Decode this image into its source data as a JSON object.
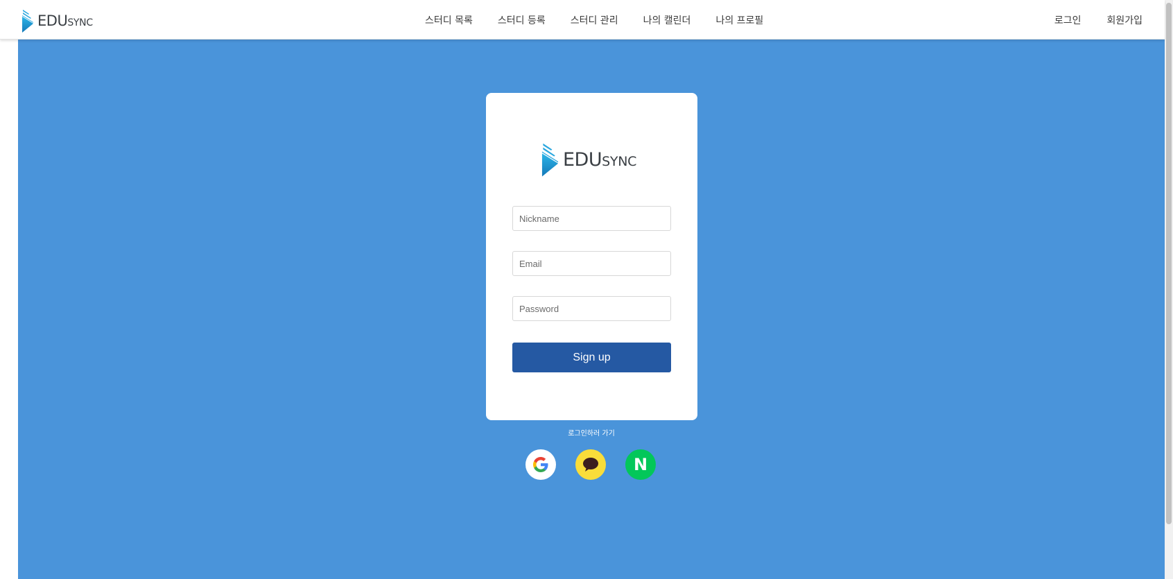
{
  "brand": {
    "name_main": "EDU",
    "name_sub": "SYNC"
  },
  "header": {
    "nav": [
      {
        "label": "스터디 목록"
      },
      {
        "label": "스터디 등록"
      },
      {
        "label": "스터디 관리"
      },
      {
        "label": "나의 캘린더"
      },
      {
        "label": "나의 프로필"
      }
    ],
    "auth": {
      "login_label": "로그인",
      "signup_label": "회원가입"
    }
  },
  "form": {
    "nickname": {
      "placeholder": "Nickname",
      "value": ""
    },
    "email": {
      "placeholder": "Email",
      "value": ""
    },
    "password": {
      "placeholder": "Password",
      "value": ""
    },
    "submit_label": "Sign up"
  },
  "footer": {
    "login_link": "로그인하러 가기",
    "social": [
      {
        "name": "google-icon"
      },
      {
        "name": "kakao-icon"
      },
      {
        "name": "naver-icon",
        "letter": "N"
      }
    ]
  },
  "colors": {
    "background": "#4a94da",
    "button": "#2559a3",
    "logo_mark": "#1fa3dd",
    "kakao": "#f9dd3a",
    "naver": "#03c75a"
  }
}
